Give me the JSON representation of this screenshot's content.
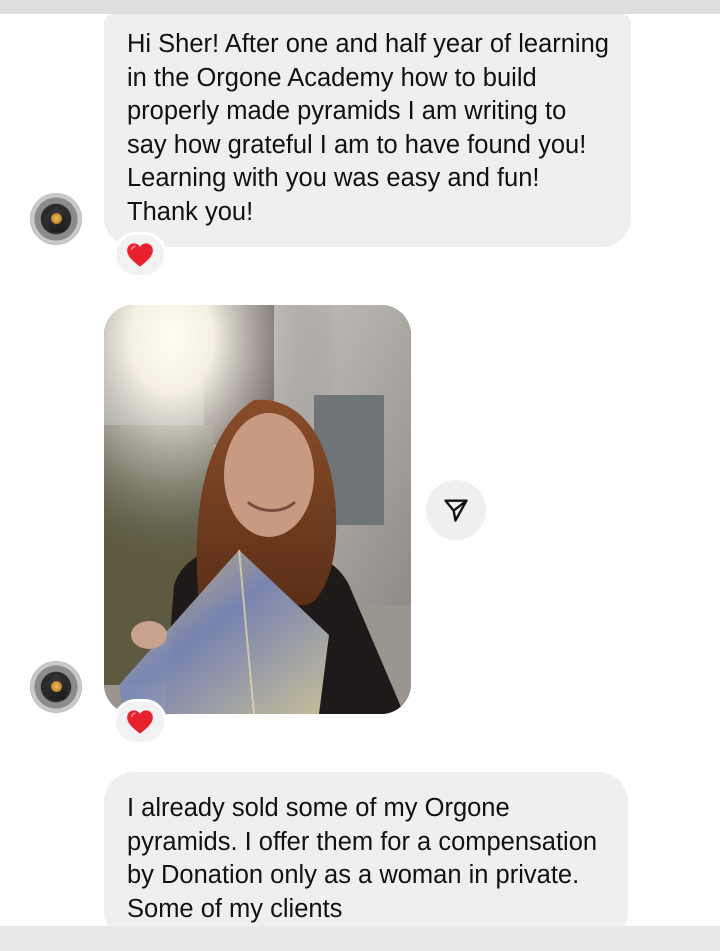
{
  "messages": [
    {
      "type": "text",
      "text": "Hi Sher! After one and half year of learning in the Orgone Academy how to build properly made pyramids I am writing to say how grateful I am to have found you! Learning with you was easy and fun! Thank you!",
      "reaction": "❤️"
    },
    {
      "type": "photo",
      "reaction": "❤️"
    },
    {
      "type": "text",
      "text": "I already sold some of my Orgone pyramids. I offer them for a compensation by Donation only as a woman in private. Some of my clients"
    }
  ],
  "icons": {
    "avatar": "avatar-icon",
    "reaction": "heart-icon",
    "share": "send-arrow-icon"
  },
  "colors": {
    "bubble": "#efefef",
    "heart": "#e8212f",
    "text": "#111111"
  }
}
